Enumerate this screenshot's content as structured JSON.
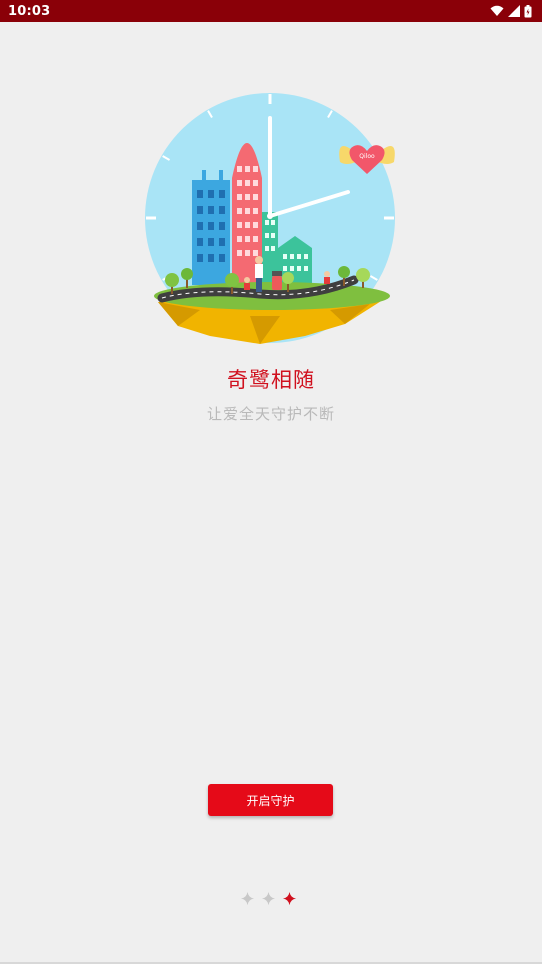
{
  "status_bar": {
    "time": "10:03",
    "icons": [
      "wifi-icon",
      "signal-icon",
      "battery-icon"
    ],
    "background": "#8a0008"
  },
  "onboarding": {
    "title": "奇鹭相随",
    "subtitle": "让爱全天守护不断",
    "button_label": "开启守护",
    "logo_text": "Qiloo",
    "page_indicator": {
      "total": 3,
      "active": 3
    }
  },
  "colors": {
    "accent": "#e50a18",
    "title": "#d0101e",
    "subtitle": "#b9b9b9",
    "background": "#efefef"
  }
}
